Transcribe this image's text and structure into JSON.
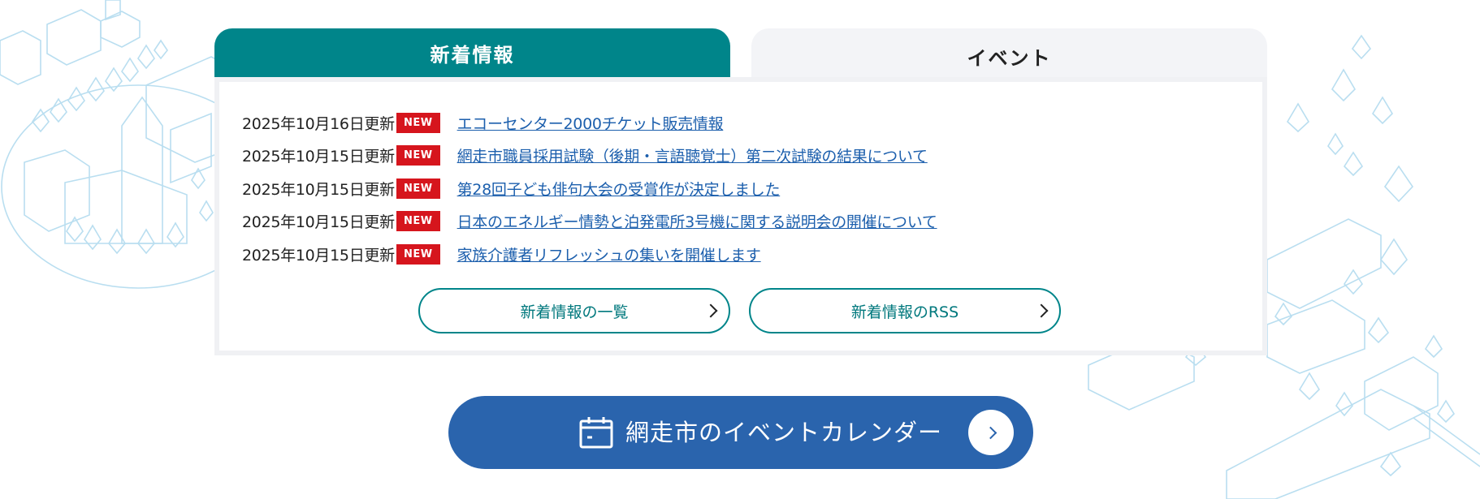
{
  "tabs": [
    {
      "label": "新着情報",
      "active": true
    },
    {
      "label": "イベント",
      "active": false
    }
  ],
  "news": [
    {
      "date": "2025年10月16日更新",
      "badge": "NEW",
      "title": "エコーセンター2000チケット販売情報"
    },
    {
      "date": "2025年10月15日更新",
      "badge": "NEW",
      "title": "網走市職員採用試験（後期・言語聴覚士）第二次試験の結果について"
    },
    {
      "date": "2025年10月15日更新",
      "badge": "NEW",
      "title": "第28回子ども俳句大会の受賞作が決定しました"
    },
    {
      "date": "2025年10月15日更新",
      "badge": "NEW",
      "title": "日本のエネルギー情勢と泊発電所3号機に関する説明会の開催について"
    },
    {
      "date": "2025年10月15日更新",
      "badge": "NEW",
      "title": "家族介護者リフレッシュの集いを開催します"
    }
  ],
  "buttons": {
    "list": "新着情報の一覧",
    "rss": "新着情報のRSS"
  },
  "calendar": {
    "label": "網走市のイベントカレンダー",
    "icon": "calendar-icon"
  },
  "colors": {
    "teal": "#00858a",
    "badge_red": "#d6151d",
    "link_blue": "#1c5fad",
    "calendar_blue": "#2a64ad",
    "illustration": "#b9def0"
  }
}
